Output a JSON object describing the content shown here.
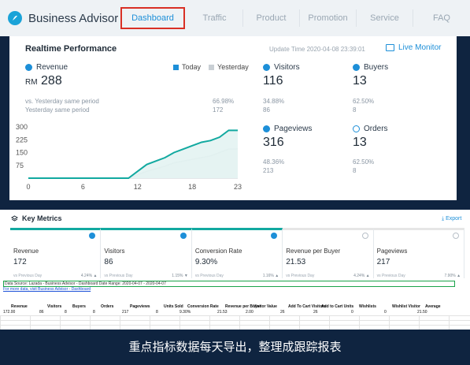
{
  "nav": {
    "brand": "Business Advisor",
    "tabs": [
      "Dashboard",
      "Traffic",
      "Product",
      "Promotion",
      "Service",
      "FAQ"
    ],
    "active_tab": "Dashboard"
  },
  "realtime": {
    "title": "Realtime Performance",
    "update_time": "Update Time 2020-04-08 23:39:01",
    "live_monitor": "Live Monitor",
    "revenue": {
      "label": "Revenue",
      "currency": "RM",
      "value": "288",
      "compare_label_1": "vs. Yesterday same period",
      "compare_label_2": "Yesterday same period",
      "compare_pct": "66.98%",
      "compare_val": "172"
    },
    "legend_today": "Today",
    "legend_yesterday": "Yesterday",
    "visitors": {
      "label": "Visitors",
      "value": "116",
      "pct": "34.88%",
      "prev": "86"
    },
    "buyers": {
      "label": "Buyers",
      "value": "13",
      "pct": "62.50%",
      "prev": "8"
    },
    "pageviews": {
      "label": "Pageviews",
      "value": "316",
      "pct": "48.36%",
      "prev": "213"
    },
    "orders": {
      "label": "Orders",
      "value": "13",
      "pct": "62.50%",
      "prev": "8"
    }
  },
  "chart_data": {
    "type": "area",
    "x": [
      0,
      1,
      2,
      3,
      4,
      5,
      6,
      7,
      8,
      9,
      10,
      11,
      12,
      13,
      14,
      15,
      16,
      17,
      18,
      19,
      20,
      21,
      22,
      23
    ],
    "xticks": [
      "0",
      "6",
      "12",
      "18",
      "23"
    ],
    "yticks": [
      "300",
      "225",
      "150",
      "75"
    ],
    "ylim": [
      0,
      300
    ],
    "series": [
      {
        "name": "Today",
        "color": "#12a9a0",
        "values": [
          0,
          0,
          0,
          0,
          0,
          0,
          0,
          0,
          0,
          0,
          0,
          0,
          40,
          80,
          100,
          120,
          150,
          170,
          190,
          210,
          220,
          240,
          280,
          280
        ]
      },
      {
        "name": "Yesterday",
        "color": "#c9cfd4",
        "values": [
          0,
          0,
          0,
          0,
          0,
          0,
          0,
          0,
          0,
          0,
          0,
          0,
          20,
          40,
          55,
          70,
          90,
          100,
          110,
          120,
          130,
          150,
          170,
          172
        ]
      }
    ]
  },
  "key_metrics": {
    "title": "Key Metrics",
    "export": "Export",
    "prev_label": "vs Previous Day",
    "cells": [
      {
        "label": "Revenue",
        "value": "172",
        "pct": "4.24%",
        "selected": true
      },
      {
        "label": "Visitors",
        "value": "86",
        "pct": "1.15%",
        "selected": true
      },
      {
        "label": "Conversion Rate",
        "value": "9.30%",
        "pct": "1.16%",
        "selected": true
      },
      {
        "label": "Revenue per Buyer",
        "value": "21.53",
        "pct": "4.24%",
        "selected": false
      },
      {
        "label": "Pageviews",
        "value": "217",
        "pct": "7.90%",
        "selected": false
      }
    ]
  },
  "sheet": {
    "source": "Data Source: Lazada - Business Advisor - Dashboard  Date Range: 2020-04-07 - 2020-04-07",
    "link": "For more data, visit Business Advisor - Dashboard",
    "headers": [
      "Revenue",
      "Visitors",
      "Buyers",
      "Orders",
      "Pageviews",
      "Units Sold",
      "Conversion Rate",
      "Revenue per Buyer",
      "Visitor Value",
      "Add To Cart Visitors",
      "Add to Cart Units",
      "Wishlists",
      "Wishlist Visitor",
      "Average"
    ],
    "row": [
      "172.00",
      "86",
      "8",
      "8",
      "217",
      "8",
      "9.30%",
      "21.53",
      "2.00",
      "26",
      "26",
      "0",
      "0",
      "21.50"
    ]
  },
  "caption": "重点指标数据每天导出，整理成跟踪报表"
}
